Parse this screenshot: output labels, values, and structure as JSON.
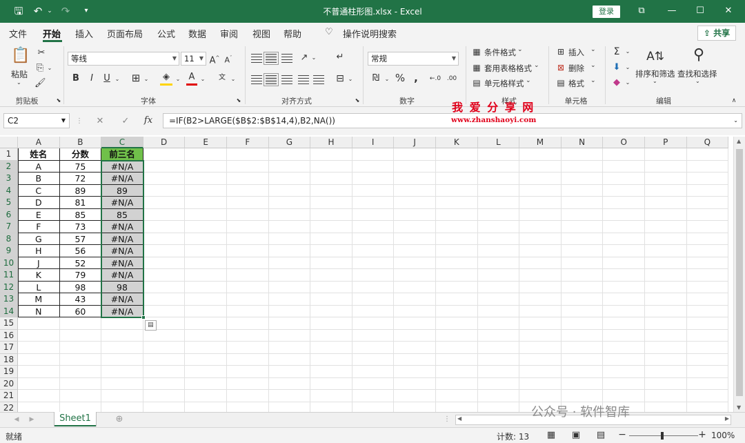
{
  "titlebar": {
    "title": "不普通柱形图.xlsx  -  Excel",
    "login": "登录"
  },
  "tabs": [
    "文件",
    "开始",
    "插入",
    "页面布局",
    "公式",
    "数据",
    "审阅",
    "视图",
    "帮助"
  ],
  "tell_me": "操作说明搜索",
  "share": "共享",
  "ribbon": {
    "paste": "粘贴",
    "font_name": "等线",
    "font_size": "11",
    "number_format": "常规",
    "cond_format": "条件格式",
    "table_format": "套用表格格式",
    "cell_style": "单元格样式",
    "insert": "插入",
    "delete": "删除",
    "format": "格式",
    "sort_filter": "排序和筛选",
    "find_select": "查找和选择",
    "groups": {
      "clipboard": "剪贴板",
      "font": "字体",
      "alignment": "对齐方式",
      "number": "数字",
      "styles": "样式",
      "cells": "单元格",
      "editing": "编辑"
    }
  },
  "formula_bar": {
    "name_box": "C2",
    "formula": "=IF(B2>LARGE($B$2:$B$14,4),B2,NA())"
  },
  "watermark": {
    "cn": "我 爱 分 享 网",
    "url": "www.zhanshaoyi.com",
    "wechat": "公众号 · 软件智库"
  },
  "columns": [
    "A",
    "B",
    "C",
    "D",
    "E",
    "F",
    "G",
    "H",
    "I",
    "J",
    "K",
    "L",
    "M",
    "N",
    "O",
    "P",
    "Q"
  ],
  "row_numbers": [
    "1",
    "2",
    "3",
    "4",
    "5",
    "6",
    "7",
    "8",
    "9",
    "10",
    "11",
    "12",
    "13",
    "14",
    "15",
    "16",
    "17",
    "18",
    "19",
    "20",
    "21",
    "22"
  ],
  "sheet": {
    "rows": [
      [
        "姓名",
        "分数",
        "前三名"
      ],
      [
        "A",
        "75",
        "#N/A"
      ],
      [
        "B",
        "72",
        "#N/A"
      ],
      [
        "C",
        "89",
        "89"
      ],
      [
        "D",
        "81",
        "#N/A"
      ],
      [
        "E",
        "85",
        "85"
      ],
      [
        "F",
        "73",
        "#N/A"
      ],
      [
        "G",
        "57",
        "#N/A"
      ],
      [
        "H",
        "56",
        "#N/A"
      ],
      [
        "J",
        "52",
        "#N/A"
      ],
      [
        "K",
        "79",
        "#N/A"
      ],
      [
        "L",
        "98",
        "98"
      ],
      [
        "M",
        "43",
        "#N/A"
      ],
      [
        "N",
        "60",
        "#N/A"
      ]
    ]
  },
  "sheet_tab": "Sheet1",
  "status": {
    "ready": "就绪",
    "count": "计数: 13",
    "zoom": "100%"
  },
  "colors": {
    "accent": "#217346",
    "header_fill": "#70c04a",
    "watermark": "#e0001a"
  }
}
